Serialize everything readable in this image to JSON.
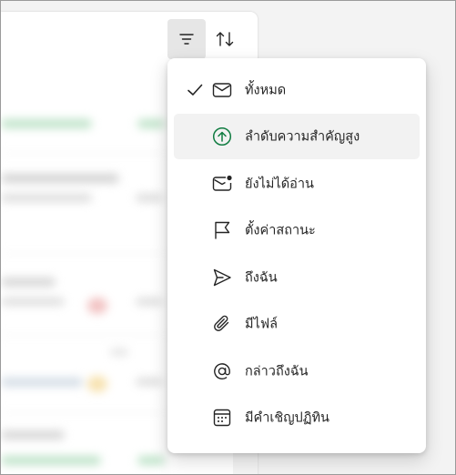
{
  "toolbar": {
    "filter_icon": "filter-icon",
    "sort_icon": "sort-arrows-icon"
  },
  "filter_menu": {
    "selected": "all",
    "items": [
      {
        "id": "all",
        "label": "ทั้งหมด",
        "icon": "mail-icon",
        "checked": true
      },
      {
        "id": "high-importance",
        "label": "ลำดับความสำคัญสูง",
        "icon": "arrow-up-circle-icon",
        "icon_color": "#107c41",
        "hovered": true
      },
      {
        "id": "unread",
        "label": "ยังไม่ได้อ่าน",
        "icon": "mail-unread-icon"
      },
      {
        "id": "flagged",
        "label": "ตั้งค่าสถานะ",
        "icon": "flag-icon"
      },
      {
        "id": "to-me",
        "label": "ถึงฉัน",
        "icon": "send-icon"
      },
      {
        "id": "has-files",
        "label": "มีไฟล์",
        "icon": "paperclip-icon"
      },
      {
        "id": "mentions-me",
        "label": "กล่าวถึงฉัน",
        "icon": "at-icon"
      },
      {
        "id": "has-invites",
        "label": "มีคำเชิญปฏิทิน",
        "icon": "calendar-icon"
      }
    ]
  }
}
